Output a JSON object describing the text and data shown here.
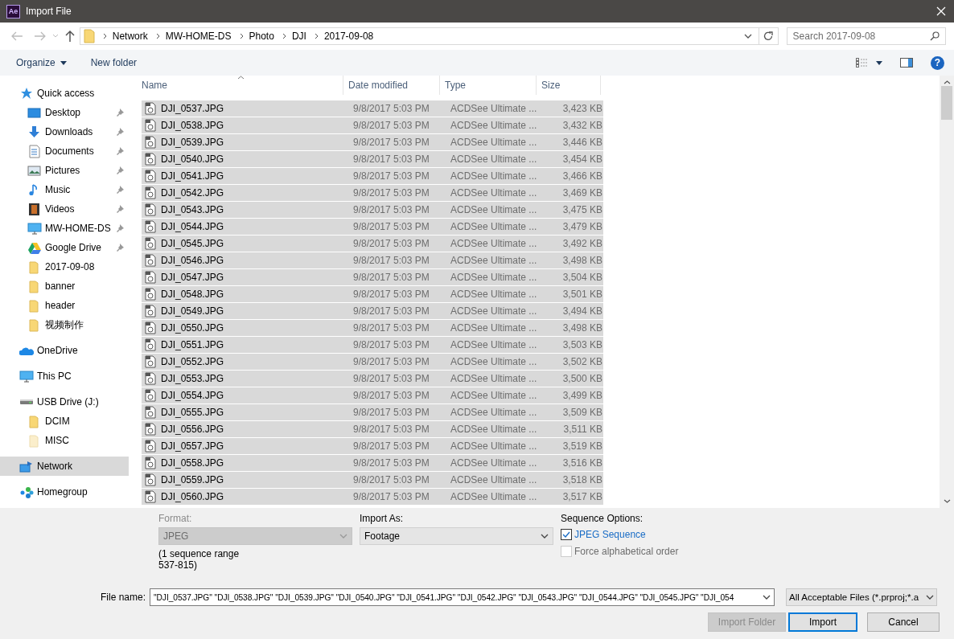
{
  "window": {
    "app_badge": "Ae",
    "title": "Import File"
  },
  "address_bar": {
    "path": [
      "Network",
      "MW-HOME-DS",
      "Photo",
      "DJI",
      "2017-09-08"
    ]
  },
  "search": {
    "placeholder": "Search 2017-09-08"
  },
  "toolbar": {
    "organize": "Organize",
    "new_folder": "New folder",
    "help": "?"
  },
  "nav_pane": {
    "items": [
      {
        "label": "Quick access",
        "kind": "star",
        "selected": false,
        "children": [
          {
            "label": "Desktop",
            "kind": "desktop",
            "pinned": true,
            "selected": false
          },
          {
            "label": "Downloads",
            "kind": "download",
            "pinned": true,
            "selected": false
          },
          {
            "label": "Documents",
            "kind": "document",
            "pinned": true,
            "selected": false
          },
          {
            "label": "Pictures",
            "kind": "picture",
            "pinned": true,
            "selected": false
          },
          {
            "label": "Music",
            "kind": "music",
            "pinned": true,
            "selected": false
          },
          {
            "label": "Videos",
            "kind": "video",
            "pinned": true,
            "selected": false
          },
          {
            "label": "MW-HOME-DS",
            "kind": "computer",
            "pinned": true,
            "selected": false
          },
          {
            "label": "Google Drive",
            "kind": "drive",
            "pinned": true,
            "selected": false
          },
          {
            "label": "2017-09-08",
            "kind": "folder",
            "pinned": false,
            "selected": false
          },
          {
            "label": "banner",
            "kind": "folder",
            "pinned": false,
            "selected": false
          },
          {
            "label": "header",
            "kind": "folder",
            "pinned": false,
            "selected": false
          },
          {
            "label": "视频制作",
            "kind": "folder",
            "pinned": false,
            "selected": false
          }
        ]
      },
      {
        "label": "OneDrive",
        "kind": "cloud",
        "selected": false
      },
      {
        "label": "This PC",
        "kind": "computer",
        "selected": false
      },
      {
        "label": "USB Drive (J:)",
        "kind": "usb",
        "selected": false,
        "children": [
          {
            "label": "DCIM",
            "kind": "folder",
            "pinned": false,
            "selected": false
          },
          {
            "label": "MISC",
            "kind": "folder-faded",
            "pinned": false,
            "selected": false
          }
        ]
      },
      {
        "label": "Network",
        "kind": "network",
        "selected": true
      },
      {
        "label": "Homegroup",
        "kind": "homegroup",
        "selected": false
      }
    ]
  },
  "file_list": {
    "columns": [
      "Name",
      "Date modified",
      "Type",
      "Size"
    ],
    "rows": [
      {
        "name": "DJI_0537.JPG",
        "date": "9/8/2017 5:03 PM",
        "type": "ACDSee Ultimate ...",
        "size": "3,423 KB",
        "selected": true
      },
      {
        "name": "DJI_0538.JPG",
        "date": "9/8/2017 5:03 PM",
        "type": "ACDSee Ultimate ...",
        "size": "3,432 KB",
        "selected": true
      },
      {
        "name": "DJI_0539.JPG",
        "date": "9/8/2017 5:03 PM",
        "type": "ACDSee Ultimate ...",
        "size": "3,446 KB",
        "selected": true
      },
      {
        "name": "DJI_0540.JPG",
        "date": "9/8/2017 5:03 PM",
        "type": "ACDSee Ultimate ...",
        "size": "3,454 KB",
        "selected": true
      },
      {
        "name": "DJI_0541.JPG",
        "date": "9/8/2017 5:03 PM",
        "type": "ACDSee Ultimate ...",
        "size": "3,466 KB",
        "selected": true
      },
      {
        "name": "DJI_0542.JPG",
        "date": "9/8/2017 5:03 PM",
        "type": "ACDSee Ultimate ...",
        "size": "3,469 KB",
        "selected": true
      },
      {
        "name": "DJI_0543.JPG",
        "date": "9/8/2017 5:03 PM",
        "type": "ACDSee Ultimate ...",
        "size": "3,475 KB",
        "selected": true
      },
      {
        "name": "DJI_0544.JPG",
        "date": "9/8/2017 5:03 PM",
        "type": "ACDSee Ultimate ...",
        "size": "3,479 KB",
        "selected": true
      },
      {
        "name": "DJI_0545.JPG",
        "date": "9/8/2017 5:03 PM",
        "type": "ACDSee Ultimate ...",
        "size": "3,492 KB",
        "selected": true
      },
      {
        "name": "DJI_0546.JPG",
        "date": "9/8/2017 5:03 PM",
        "type": "ACDSee Ultimate ...",
        "size": "3,498 KB",
        "selected": true
      },
      {
        "name": "DJI_0547.JPG",
        "date": "9/8/2017 5:03 PM",
        "type": "ACDSee Ultimate ...",
        "size": "3,504 KB",
        "selected": true
      },
      {
        "name": "DJI_0548.JPG",
        "date": "9/8/2017 5:03 PM",
        "type": "ACDSee Ultimate ...",
        "size": "3,501 KB",
        "selected": true
      },
      {
        "name": "DJI_0549.JPG",
        "date": "9/8/2017 5:03 PM",
        "type": "ACDSee Ultimate ...",
        "size": "3,494 KB",
        "selected": true
      },
      {
        "name": "DJI_0550.JPG",
        "date": "9/8/2017 5:03 PM",
        "type": "ACDSee Ultimate ...",
        "size": "3,498 KB",
        "selected": true
      },
      {
        "name": "DJI_0551.JPG",
        "date": "9/8/2017 5:03 PM",
        "type": "ACDSee Ultimate ...",
        "size": "3,503 KB",
        "selected": true
      },
      {
        "name": "DJI_0552.JPG",
        "date": "9/8/2017 5:03 PM",
        "type": "ACDSee Ultimate ...",
        "size": "3,502 KB",
        "selected": true
      },
      {
        "name": "DJI_0553.JPG",
        "date": "9/8/2017 5:03 PM",
        "type": "ACDSee Ultimate ...",
        "size": "3,500 KB",
        "selected": true
      },
      {
        "name": "DJI_0554.JPG",
        "date": "9/8/2017 5:03 PM",
        "type": "ACDSee Ultimate ...",
        "size": "3,499 KB",
        "selected": true
      },
      {
        "name": "DJI_0555.JPG",
        "date": "9/8/2017 5:03 PM",
        "type": "ACDSee Ultimate ...",
        "size": "3,509 KB",
        "selected": true
      },
      {
        "name": "DJI_0556.JPG",
        "date": "9/8/2017 5:03 PM",
        "type": "ACDSee Ultimate ...",
        "size": "3,511 KB",
        "selected": true
      },
      {
        "name": "DJI_0557.JPG",
        "date": "9/8/2017 5:03 PM",
        "type": "ACDSee Ultimate ...",
        "size": "3,519 KB",
        "selected": true
      },
      {
        "name": "DJI_0558.JPG",
        "date": "9/8/2017 5:03 PM",
        "type": "ACDSee Ultimate ...",
        "size": "3,516 KB",
        "selected": true
      },
      {
        "name": "DJI_0559.JPG",
        "date": "9/8/2017 5:03 PM",
        "type": "ACDSee Ultimate ...",
        "size": "3,518 KB",
        "selected": true
      },
      {
        "name": "DJI_0560.JPG",
        "date": "9/8/2017 5:03 PM",
        "type": "ACDSee Ultimate ...",
        "size": "3,517 KB",
        "selected": true
      }
    ]
  },
  "options": {
    "format": {
      "label": "Format:",
      "value": "JPEG",
      "disabled": true
    },
    "import_as": {
      "label": "Import As:",
      "value": "Footage",
      "disabled": false
    },
    "sequence_note": "(1 sequence range 537-815)",
    "sequence_label": "Sequence Options:",
    "checkboxes": [
      {
        "label": "JPEG Sequence",
        "checked": true,
        "disabled": false
      },
      {
        "label": "Force alphabetical order",
        "checked": false,
        "disabled": true
      }
    ]
  },
  "footer": {
    "file_name_label": "File name:",
    "file_name_value": "\"DJI_0537.JPG\" \"DJI_0538.JPG\" \"DJI_0539.JPG\" \"DJI_0540.JPG\" \"DJI_0541.JPG\" \"DJI_0542.JPG\" \"DJI_0543.JPG\" \"DJI_0544.JPG\" \"DJI_0545.JPG\" \"DJI_054",
    "filter": "All Acceptable Files (*.prproj;*.a",
    "buttons": [
      {
        "label": "Import Folder",
        "disabled": true,
        "default": false
      },
      {
        "label": "Import",
        "disabled": false,
        "default": true
      },
      {
        "label": "Cancel",
        "disabled": false,
        "default": false
      }
    ]
  }
}
